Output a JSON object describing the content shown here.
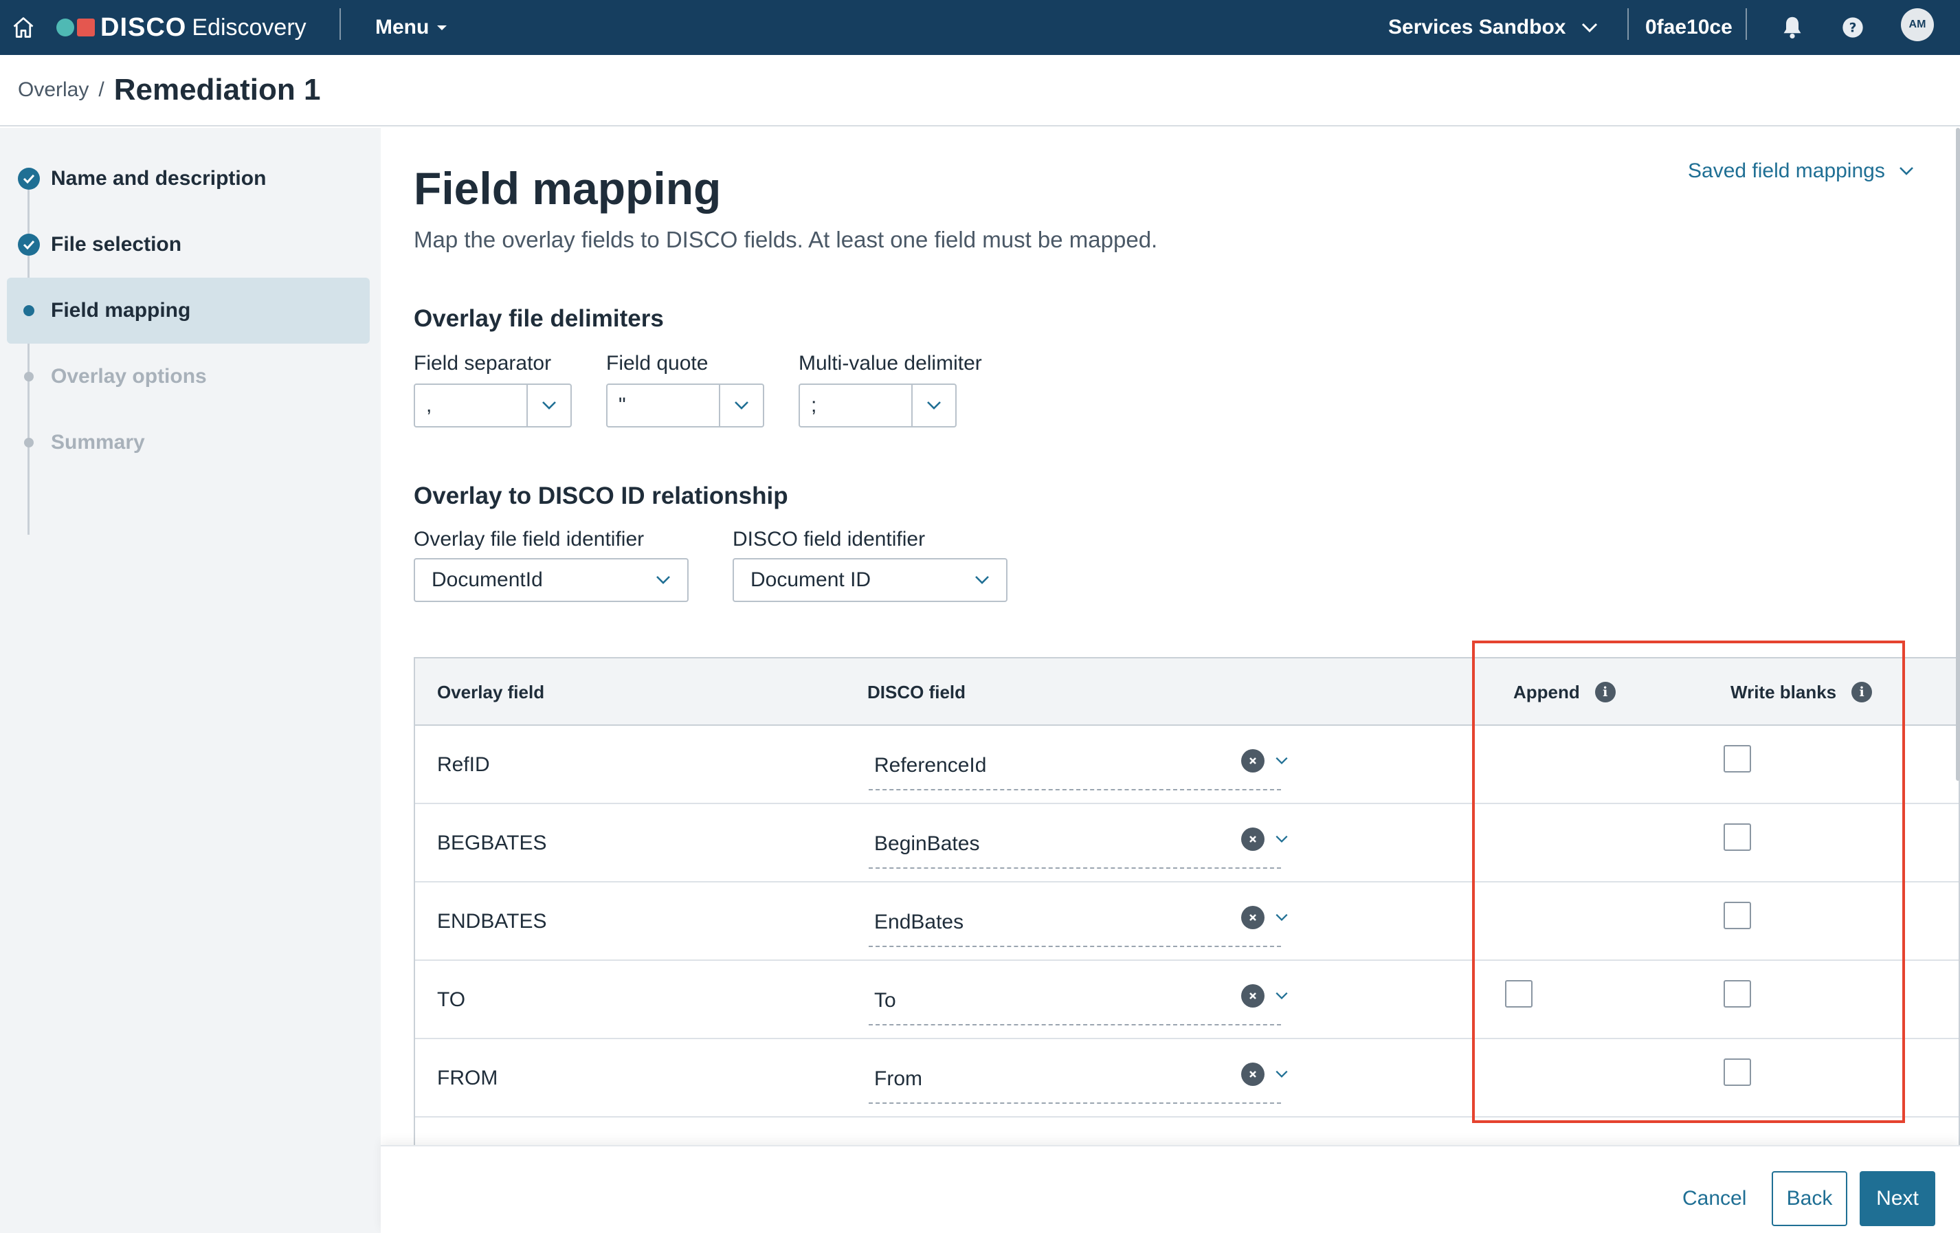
{
  "app": {
    "brand": "DISCO",
    "product": "Ediscovery",
    "menu_label": "Menu",
    "workspace": "Services Sandbox",
    "user_id": "0fae10ce",
    "avatar_initials": "AM",
    "header_bg": "#163e5f",
    "accent": "#1f6f94"
  },
  "breadcrumb": {
    "parent": "Overlay",
    "separator": "/",
    "current": "Remediation 1"
  },
  "steps": [
    {
      "label": "Name and description",
      "state": "complete"
    },
    {
      "label": "File selection",
      "state": "complete"
    },
    {
      "label": "Field mapping",
      "state": "active"
    },
    {
      "label": "Overlay options",
      "state": "disabled"
    },
    {
      "label": "Summary",
      "state": "disabled"
    }
  ],
  "main": {
    "title": "Field mapping",
    "subtitle": "Map the overlay fields to DISCO fields. At least one field must be mapped.",
    "saved_mappings_label": "Saved field mappings"
  },
  "delimiters": {
    "heading": "Overlay file delimiters",
    "field_separator": {
      "label": "Field separator",
      "value": ","
    },
    "field_quote": {
      "label": "Field quote",
      "value": "\""
    },
    "multi_value": {
      "label": "Multi-value delimiter",
      "value": ";"
    }
  },
  "relationship": {
    "heading": "Overlay to DISCO ID relationship",
    "overlay_identifier": {
      "label": "Overlay file field identifier",
      "value": "DocumentId"
    },
    "disco_identifier": {
      "label": "DISCO field identifier",
      "value": "Document ID"
    }
  },
  "table": {
    "headers": {
      "overlay_field": "Overlay field",
      "disco_field": "DISCO field",
      "append": "Append",
      "write_blanks": "Write blanks"
    },
    "rows": [
      {
        "overlay": "RefID",
        "disco": "ReferenceId",
        "append_available": false,
        "append_checked": false,
        "write_blanks_checked": false
      },
      {
        "overlay": "BEGBATES",
        "disco": "BeginBates",
        "append_available": false,
        "append_checked": false,
        "write_blanks_checked": false
      },
      {
        "overlay": "ENDBATES",
        "disco": "EndBates",
        "append_available": false,
        "append_checked": false,
        "write_blanks_checked": false
      },
      {
        "overlay": "TO",
        "disco": "To",
        "append_available": true,
        "append_checked": false,
        "write_blanks_checked": false
      },
      {
        "overlay": "FROM",
        "disco": "From",
        "append_available": false,
        "append_checked": false,
        "write_blanks_checked": false
      }
    ]
  },
  "footer": {
    "cancel": "Cancel",
    "back": "Back",
    "next": "Next"
  },
  "annotation": {
    "highlight_color": "#e5432f"
  },
  "icons": {
    "home": "home-icon",
    "bell": "bell-icon",
    "help": "help-icon",
    "info": "i"
  }
}
